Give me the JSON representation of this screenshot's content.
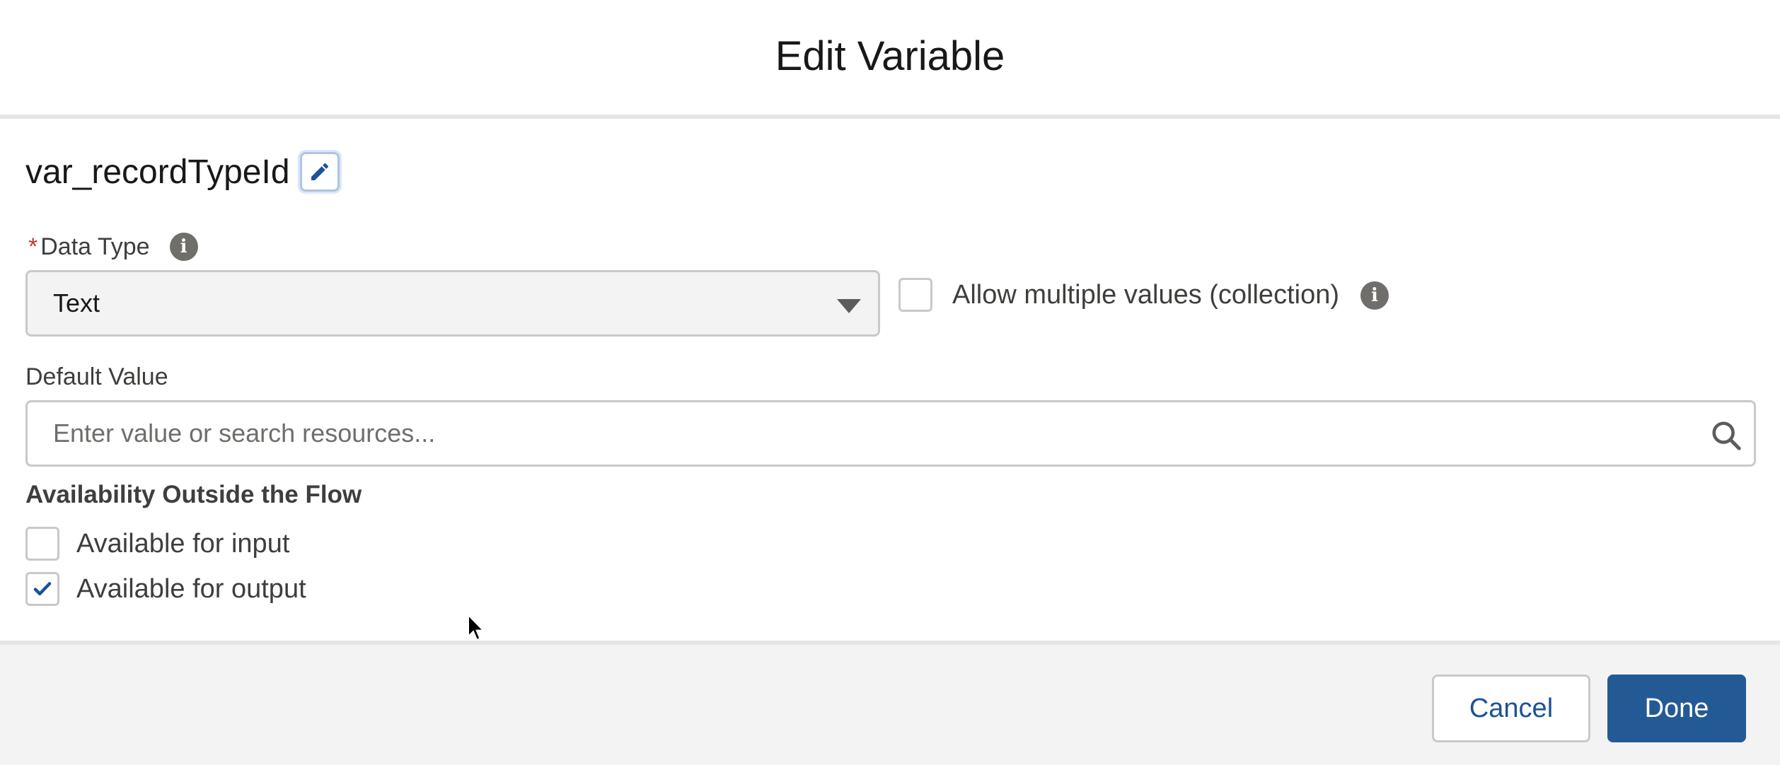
{
  "modal": {
    "title": "Edit Variable"
  },
  "variable": {
    "api_name": "var_recordTypeId",
    "edit_icon": "pencil-icon"
  },
  "data_type": {
    "label": "Data Type",
    "required_marker": "*",
    "info_icon": "info-icon",
    "selected": "Text"
  },
  "collection": {
    "label": "Allow multiple values (collection)",
    "checked": false,
    "info_icon": "info-icon"
  },
  "default_value": {
    "label": "Default Value",
    "value": "",
    "placeholder": "Enter value or search resources...",
    "icon": "search-icon"
  },
  "availability": {
    "heading": "Availability Outside the Flow",
    "options": [
      {
        "label": "Available for input",
        "checked": false
      },
      {
        "label": "Available for output",
        "checked": true
      }
    ]
  },
  "footer": {
    "cancel_label": "Cancel",
    "done_label": "Done"
  },
  "colors": {
    "brand": "#235a96",
    "link": "#1b5297",
    "required": "#c23934",
    "footer_bg": "#f3f3f3"
  }
}
